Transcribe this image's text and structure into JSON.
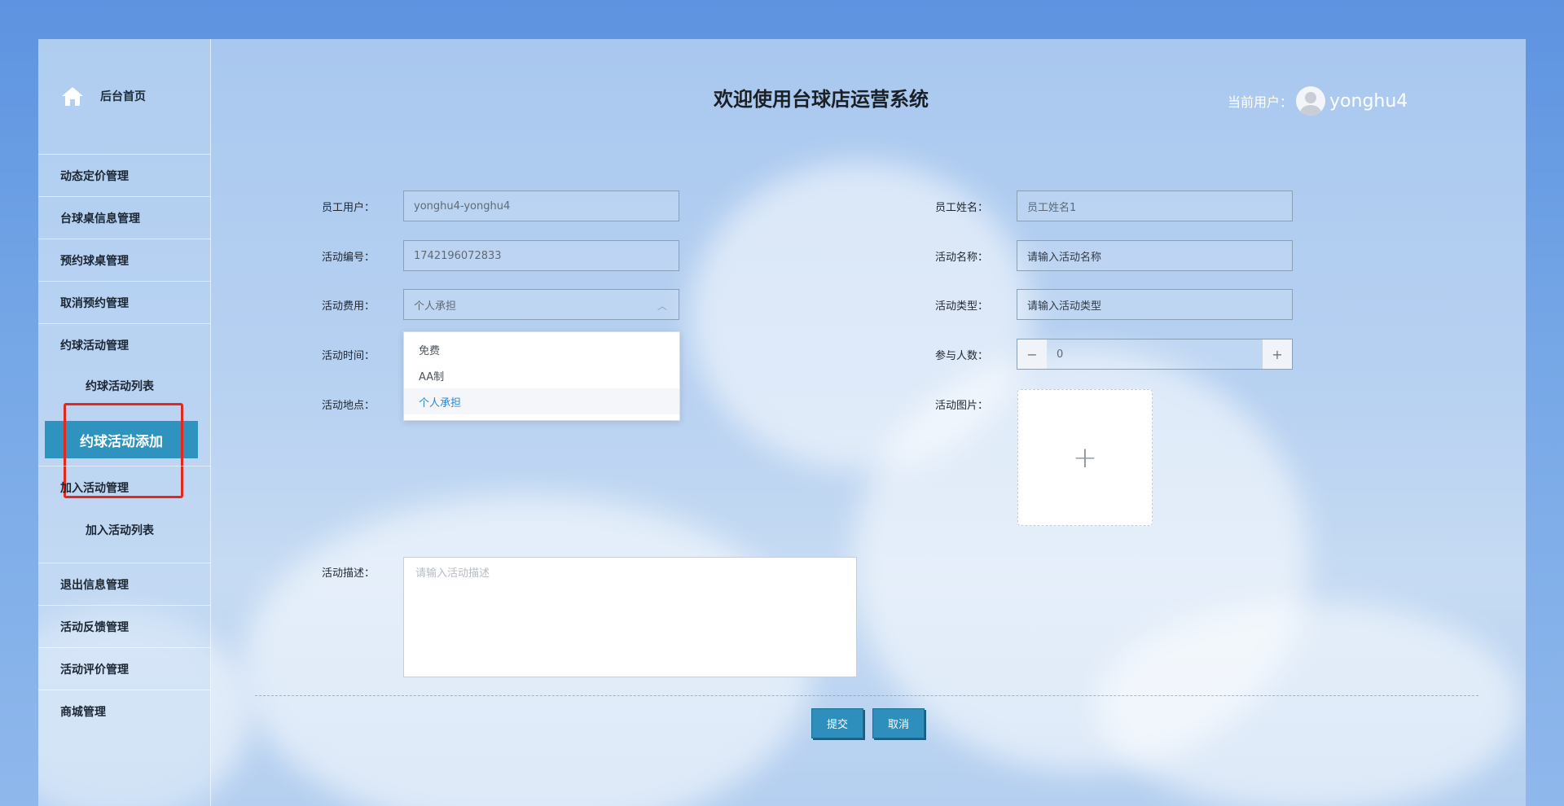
{
  "app": {
    "title": "欢迎使用台球店运营系统",
    "current_user_label": "当前用户：",
    "current_user_name": "yonghu4"
  },
  "sidebar": {
    "home_label": "后台首页",
    "items": [
      {
        "label": "动态定价管理"
      },
      {
        "label": "台球桌信息管理"
      },
      {
        "label": "预约球桌管理"
      },
      {
        "label": "取消预约管理"
      },
      {
        "label": "约球活动管理"
      },
      {
        "label": "约球活动列表"
      },
      {
        "label": "约球活动添加",
        "active": true
      },
      {
        "label": "加入活动管理"
      },
      {
        "label": "加入活动列表"
      },
      {
        "label": "退出信息管理"
      },
      {
        "label": "活动反馈管理"
      },
      {
        "label": "活动评价管理"
      },
      {
        "label": "商城管理"
      }
    ]
  },
  "form": {
    "employee_user": {
      "label": "员工用户：",
      "value": "yonghu4-yonghu4"
    },
    "employee_name": {
      "label": "员工姓名：",
      "value": "员工姓名1"
    },
    "activity_no": {
      "label": "活动编号：",
      "value": "1742196072833"
    },
    "activity_name": {
      "label": "活动名称：",
      "placeholder": "请输入活动名称"
    },
    "activity_fee": {
      "label": "活动费用：",
      "value": "个人承担",
      "options": [
        "免费",
        "AA制",
        "个人承担"
      ]
    },
    "activity_type": {
      "label": "活动类型：",
      "placeholder": "请输入活动类型"
    },
    "activity_time": {
      "label": "活动时间："
    },
    "participants": {
      "label": "参与人数：",
      "value": "0",
      "minus": "−",
      "plus": "+"
    },
    "activity_place": {
      "label": "活动地点："
    },
    "activity_image": {
      "label": "活动图片：",
      "plus": "+"
    },
    "activity_desc": {
      "label": "活动描述：",
      "placeholder": "请输入活动描述"
    }
  },
  "actions": {
    "submit": "提交",
    "cancel": "取消"
  },
  "colors": {
    "accent": "#2e93be",
    "highlight_border": "#e8261b",
    "selected_option": "#2e88d0"
  }
}
